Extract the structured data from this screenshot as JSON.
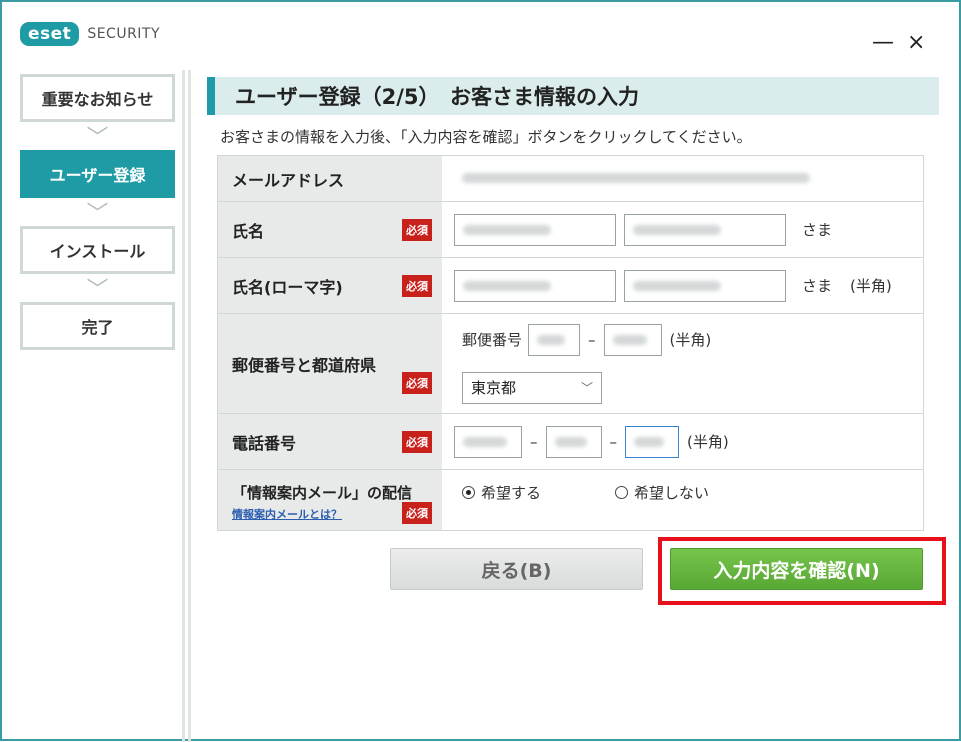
{
  "window": {
    "logo_mark": "eset",
    "logo_text": "SECURITY",
    "minimize_label": "—",
    "close_label": "×"
  },
  "sidebar": {
    "steps": [
      {
        "label": "重要なお知らせ",
        "active": false
      },
      {
        "label": "ユーザー登録",
        "active": true
      },
      {
        "label": "インストール",
        "active": false
      },
      {
        "label": "完了",
        "active": false
      }
    ],
    "separator_icon": "chevron-down-icon"
  },
  "main": {
    "heading": "ユーザー登録（2/5）　お客さま情報の入力",
    "instruction": "お客さまの情報を入力後、「入力内容を確認」ボタンをクリックしてください。"
  },
  "form": {
    "required_badge": "必須",
    "email": {
      "label": "メールアドレス"
    },
    "name": {
      "label": "氏名",
      "suffix": "さま"
    },
    "name_roman": {
      "label": "氏名(ローマ字)",
      "suffix": "さま",
      "note": "(半角)"
    },
    "postal": {
      "label": "郵便番号と都道府県",
      "postal_label": "郵便番号",
      "note": "(半角)",
      "prefecture_value": "東京都",
      "dropdown_icon": "chevron-down-icon"
    },
    "phone": {
      "label": "電話番号",
      "note": "(半角)"
    },
    "newsletter": {
      "label": "「情報案内メール」の配信",
      "help_link": "情報案内メールとは？",
      "option_yes": "希望する",
      "option_no": "希望しない",
      "selected": "希望する"
    }
  },
  "buttons": {
    "back": "戻る(B)",
    "confirm": "入力内容を確認(N)"
  },
  "colors": {
    "accent": "#1e9ba5",
    "required": "#c8211b",
    "confirm_button": "#5fb23a",
    "highlight": "#e8101a"
  }
}
